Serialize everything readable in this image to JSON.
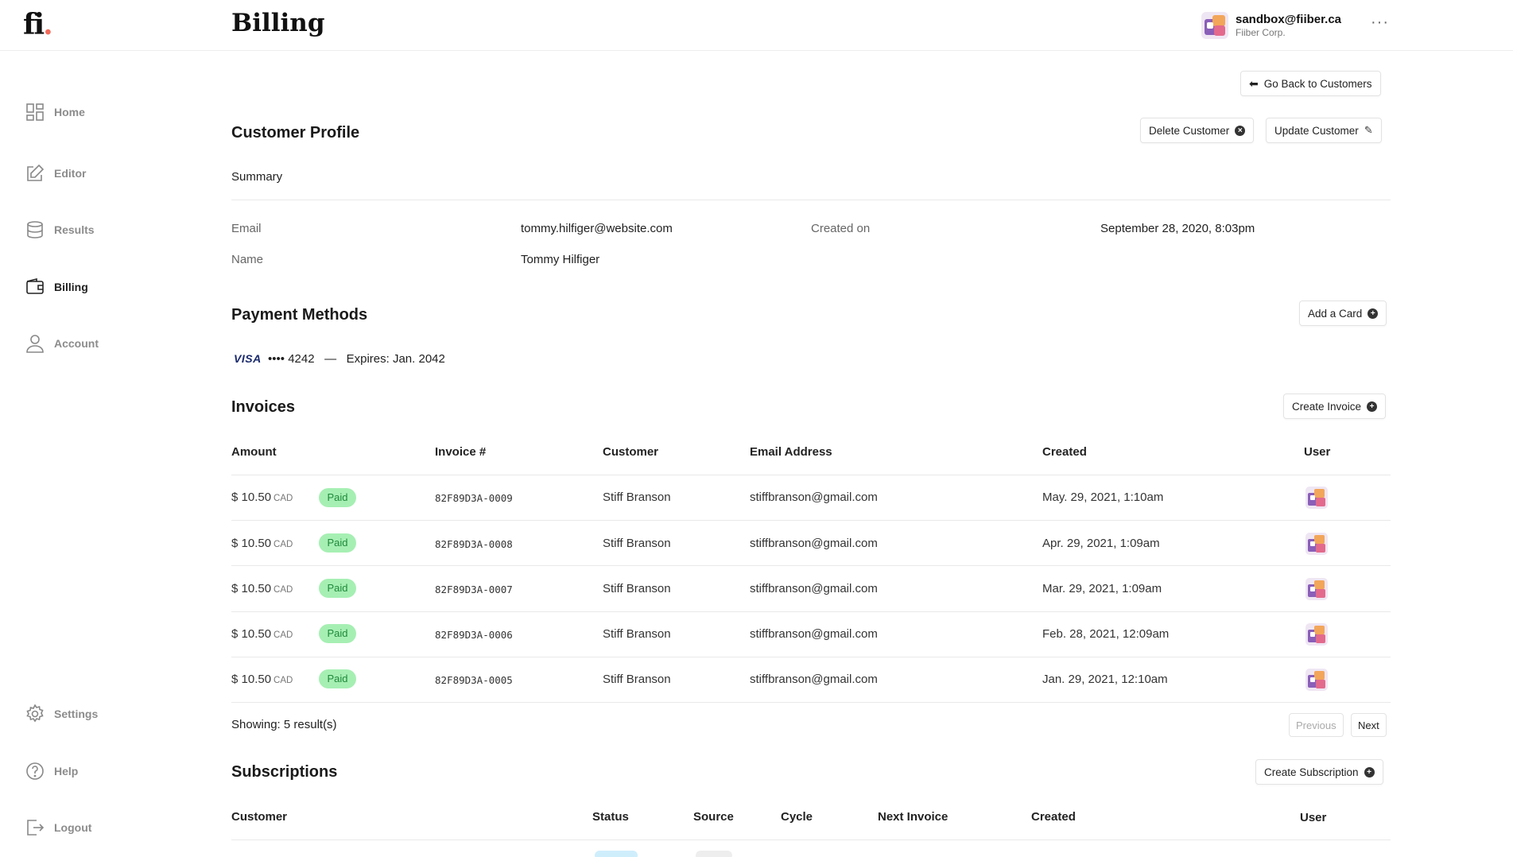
{
  "app": {
    "logo_text": "fi",
    "logo_dot": ".",
    "page_title": "Billing",
    "user_email": "sandbox@fiiber.ca",
    "user_org": "Fiiber Corp.",
    "more_label": "···"
  },
  "sidebar": {
    "items": [
      {
        "label": "Home",
        "icon": "grid-icon"
      },
      {
        "label": "Editor",
        "icon": "edit-icon"
      },
      {
        "label": "Results",
        "icon": "database-icon"
      },
      {
        "label": "Billing",
        "icon": "wallet-icon",
        "active": true
      },
      {
        "label": "Account",
        "icon": "user-icon"
      },
      {
        "label": "Settings",
        "icon": "gear-icon"
      },
      {
        "label": "Help",
        "icon": "help-icon"
      },
      {
        "label": "Logout",
        "icon": "logout-icon"
      }
    ]
  },
  "actions": {
    "go_back": "Go Back to Customers",
    "delete_customer": "Delete Customer",
    "update_customer": "Update Customer",
    "add_card": "Add a Card",
    "create_invoice": "Create Invoice",
    "create_subscription": "Create Subscription"
  },
  "profile": {
    "title": "Customer Profile",
    "summary_label": "Summary",
    "email_label": "Email",
    "email_value": "tommy.hilfiger@website.com",
    "created_label": "Created on",
    "created_value": "September 28, 2020, 8:03pm",
    "name_label": "Name",
    "name_value": "Tommy Hilfiger"
  },
  "payment": {
    "title": "Payment Methods",
    "brand": "VISA",
    "masked": "•••• 4242",
    "dash": "—",
    "expires": "Expires: Jan. 2042"
  },
  "invoices": {
    "title": "Invoices",
    "columns": [
      "Amount",
      "Invoice #",
      "Customer",
      "Email Address",
      "Created",
      "User"
    ],
    "rows": [
      {
        "amount": "$ 10.50",
        "currency": "CAD",
        "status": "Paid",
        "number": "82F89D3A-0009",
        "customer": "Stiff Branson",
        "email": "stiffbranson@gmail.com",
        "created": "May. 29, 2021, 1:10am"
      },
      {
        "amount": "$ 10.50",
        "currency": "CAD",
        "status": "Paid",
        "number": "82F89D3A-0008",
        "customer": "Stiff Branson",
        "email": "stiffbranson@gmail.com",
        "created": "Apr. 29, 2021, 1:09am"
      },
      {
        "amount": "$ 10.50",
        "currency": "CAD",
        "status": "Paid",
        "number": "82F89D3A-0007",
        "customer": "Stiff Branson",
        "email": "stiffbranson@gmail.com",
        "created": "Mar. 29, 2021, 1:09am"
      },
      {
        "amount": "$ 10.50",
        "currency": "CAD",
        "status": "Paid",
        "number": "82F89D3A-0006",
        "customer": "Stiff Branson",
        "email": "stiffbranson@gmail.com",
        "created": "Feb. 28, 2021, 12:09am"
      },
      {
        "amount": "$ 10.50",
        "currency": "CAD",
        "status": "Paid",
        "number": "82F89D3A-0005",
        "customer": "Stiff Branson",
        "email": "stiffbranson@gmail.com",
        "created": "Jan. 29, 2021, 12:10am"
      }
    ],
    "showing": "Showing: 5 result(s)",
    "previous": "Previous",
    "next": "Next"
  },
  "subscriptions": {
    "title": "Subscriptions",
    "columns": [
      "Customer",
      "Status",
      "Source",
      "Cycle",
      "Next Invoice",
      "Created",
      "User"
    ]
  },
  "colors": {
    "paid_badge_bg": "#a6efb3",
    "paid_badge_text": "#1e8a3a",
    "logo_dot": "#f26b5b"
  }
}
